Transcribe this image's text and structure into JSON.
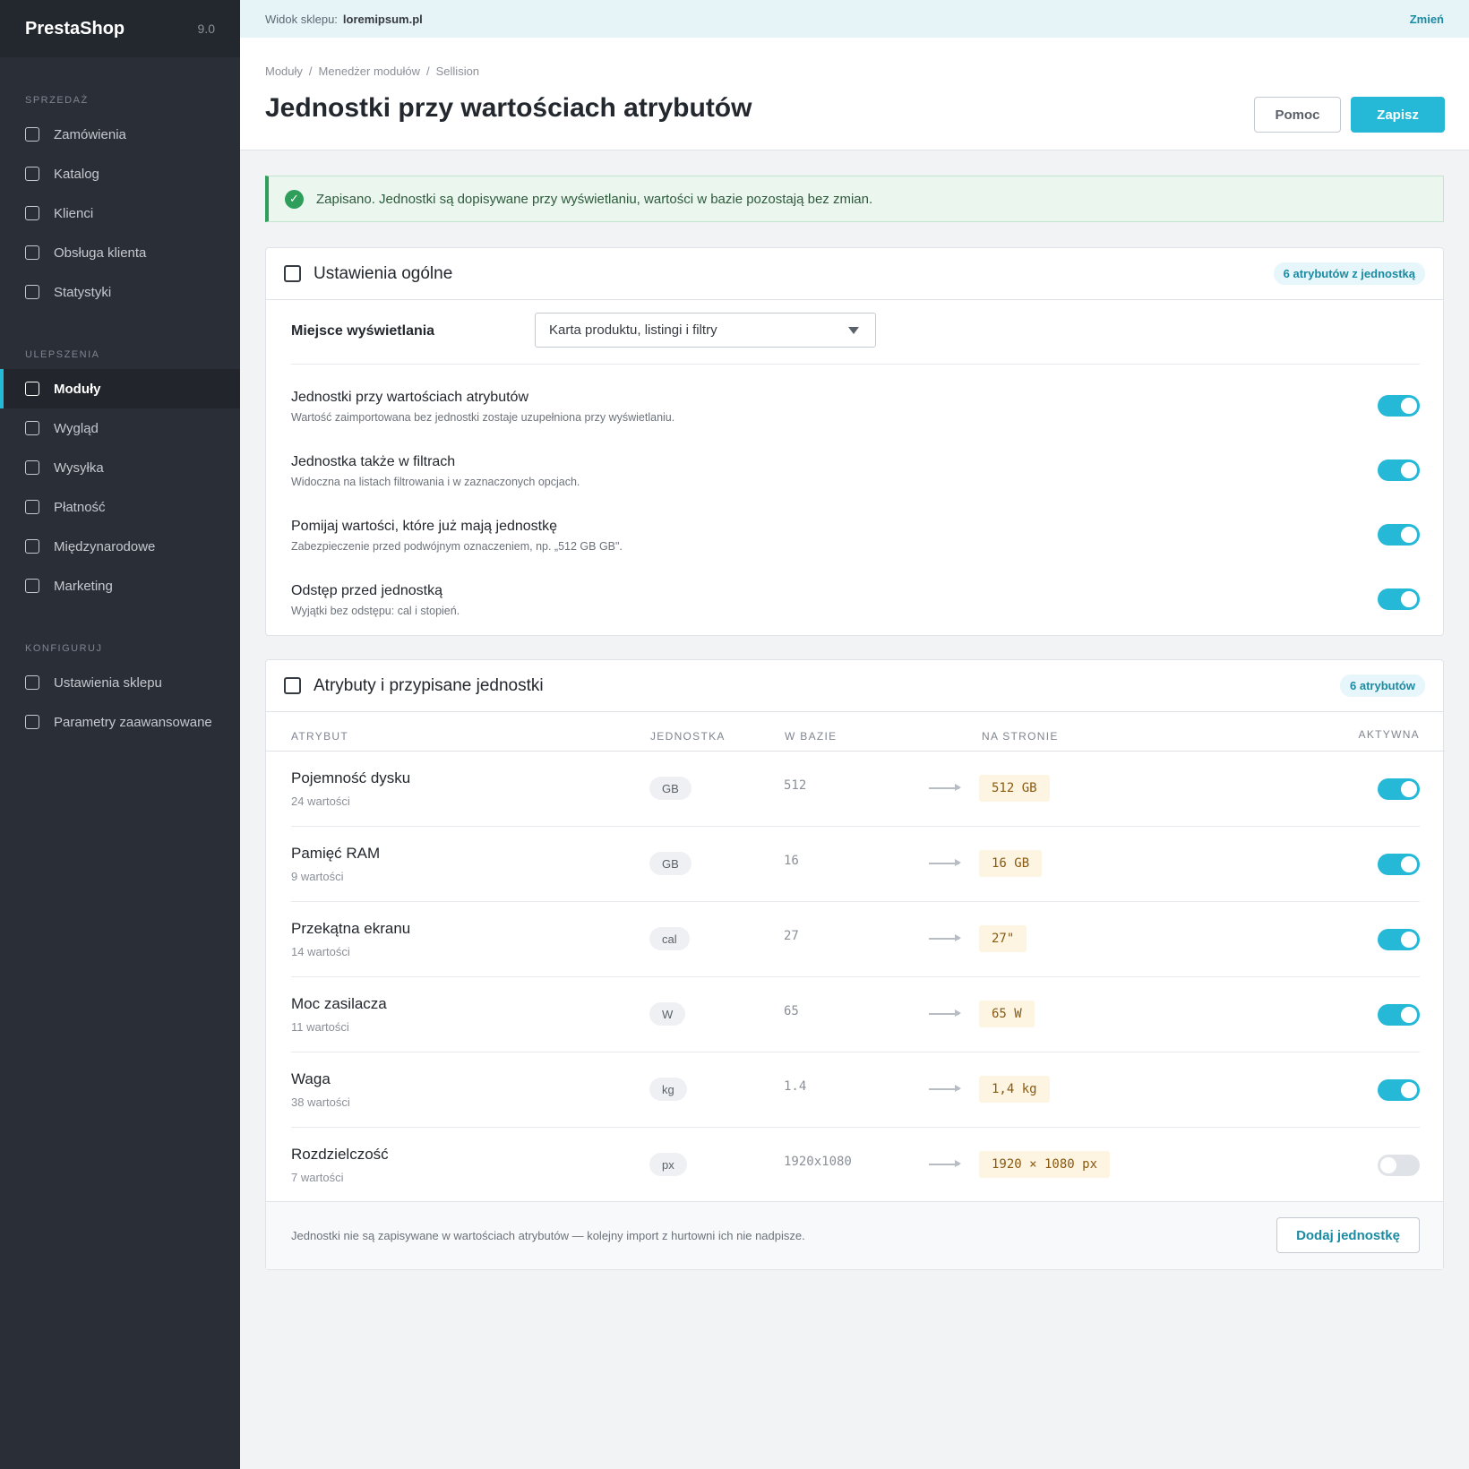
{
  "sidebar": {
    "brand": "PrestaShop",
    "version": "9.0",
    "sections": [
      {
        "title": "SPRZEDAŻ",
        "items": [
          "Zamówienia",
          "Katalog",
          "Klienci",
          "Obsługa klienta",
          "Statystyki"
        ]
      },
      {
        "title": "ULEPSZENIA",
        "items": [
          "Moduły",
          "Wygląd",
          "Wysyłka",
          "Płatność",
          "Międzynarodowe",
          "Marketing"
        ]
      },
      {
        "title": "KONFIGURUJ",
        "items": [
          "Ustawienia sklepu",
          "Parametry zaawansowane"
        ]
      }
    ],
    "active_item": "Moduły"
  },
  "topbar": {
    "label": "Widok sklepu:",
    "shop_url": "loremipsum.pl",
    "change": "Zmień"
  },
  "header": {
    "breadcrumb": [
      "Moduły",
      "Menedżer modułów",
      "Sellision"
    ],
    "title": "Jednostki przy wartościach atrybutów",
    "help_label": "Pomoc",
    "save_label": "Zapisz"
  },
  "alert": {
    "text": "Zapisano. Jednostki są dopisywane przy wyświetlaniu, wartości w bazie pozostają bez zmian."
  },
  "general": {
    "title": "Ustawienia ogólne",
    "badge": "6 atrybutów z jednostką",
    "display_label": "Miejsce wyświetlania",
    "display_value": "Karta produktu, listingi i filtry",
    "options": [
      {
        "title": "Jednostki przy wartościach atrybutów",
        "desc": "Wartość zaimportowana bez jednostki zostaje uzupełniona przy wyświetlaniu.",
        "enabled": true
      },
      {
        "title": "Jednostka także w filtrach",
        "desc": "Widoczna na listach filtrowania i w zaznaczonych opcjach.",
        "enabled": true
      },
      {
        "title": "Pomijaj wartości, które już mają jednostkę",
        "desc": "Zabezpieczenie przed podwójnym oznaczeniem, np. „512 GB GB\".",
        "enabled": true
      },
      {
        "title": "Odstęp przed jednostką",
        "desc": "Wyjątki bez odstępu: cal i stopień.",
        "enabled": true
      }
    ]
  },
  "attributes": {
    "title": "Atrybuty i przypisane jednostki",
    "badge": "6 atrybutów",
    "columns": [
      "ATRYBUT",
      "JEDNOSTKA",
      "W BAZIE",
      "NA STRONIE",
      "AKTYWNA"
    ],
    "rows": [
      {
        "name": "Pojemność dysku",
        "count": "24 wartości",
        "unit": "GB",
        "base": "512",
        "output": "512 GB",
        "active": true
      },
      {
        "name": "Pamięć RAM",
        "count": "9 wartości",
        "unit": "GB",
        "base": "16",
        "output": "16 GB",
        "active": true
      },
      {
        "name": "Przekątna ekranu",
        "count": "14 wartości",
        "unit": "cal",
        "base": "27",
        "output": "27\"",
        "active": true
      },
      {
        "name": "Moc zasilacza",
        "count": "11 wartości",
        "unit": "W",
        "base": "65",
        "output": "65 W",
        "active": true
      },
      {
        "name": "Waga",
        "count": "38 wartości",
        "unit": "kg",
        "base": "1.4",
        "output": "1,4 kg",
        "active": true
      },
      {
        "name": "Rozdzielczość",
        "count": "7 wartości",
        "unit": "px",
        "base": "1920x1080",
        "output": "1920 × 1080 px",
        "active": false
      }
    ],
    "footer_note": "Jednostki nie są zapisywane w wartościach atrybutów — kolejny import z hurtowni ich nie nadpisze.",
    "add_label": "Dodaj jednostkę"
  },
  "colors": {
    "accent": "#25b9d7",
    "sidebar": "#2a2e37",
    "success": "#2e9e5a"
  }
}
